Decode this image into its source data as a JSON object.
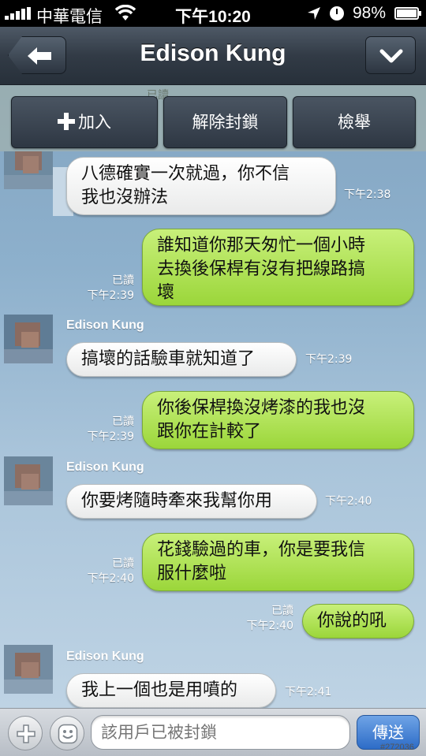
{
  "status_bar": {
    "carrier": "中華電信",
    "time": "下午10:20",
    "battery": "98%",
    "battery_level": 0.98,
    "icons": [
      "signal-icon",
      "wifi-icon",
      "location-icon",
      "clock-icon",
      "battery-icon"
    ]
  },
  "nav": {
    "title": "Edison Kung",
    "icons": [
      "back-arrow-icon",
      "chevron-down-icon"
    ]
  },
  "action_bar": {
    "add_label": "加入",
    "unblock_label": "解除封鎖",
    "report_label": "檢舉",
    "background_read": "已讀"
  },
  "messages": [
    {
      "direction": "in",
      "sender": "",
      "text": [
        "八德確實一次就過，你不信",
        "我也沒辦法"
      ],
      "time": "下午2:38"
    },
    {
      "direction": "out",
      "read": "已讀",
      "text": [
        "誰知道你那天匆忙一個小時",
        "去換後保桿有沒有把線路搞",
        "壞"
      ],
      "time": "下午2:39"
    },
    {
      "direction": "in",
      "sender": "Edison Kung",
      "text": [
        "搞壞的話驗車就知道了"
      ],
      "time": "下午2:39"
    },
    {
      "direction": "out",
      "read": "已讀",
      "text": [
        "你後保桿換沒烤漆的我也沒",
        "跟你在計較了"
      ],
      "time": "下午2:39"
    },
    {
      "direction": "in",
      "sender": "Edison Kung",
      "text": [
        "你要烤隨時牽來我幫你用"
      ],
      "time": "下午2:40"
    },
    {
      "direction": "out",
      "read": "已讀",
      "text": [
        "花錢驗過的車，你是要我信",
        "服什麼啦"
      ],
      "time": "下午2:40"
    },
    {
      "direction": "out",
      "read": "已讀",
      "text": [
        "你說的吼"
      ],
      "time": "下午2:40"
    },
    {
      "direction": "in",
      "sender": "Edison Kung",
      "text": [
        "我上一個也是用噴的"
      ],
      "time": "下午2:41"
    }
  ],
  "input_bar": {
    "placeholder": "該用戶已被封鎖",
    "send_label": "傳送",
    "icons": [
      "plus-icon",
      "emoji-icon"
    ]
  },
  "watermark": "#272036",
  "colors": {
    "outgoing_bubble": "#b3e35a",
    "incoming_bubble": "#ffffff",
    "nav_bar": "#323b46",
    "send_button": "#3d7dd6"
  }
}
